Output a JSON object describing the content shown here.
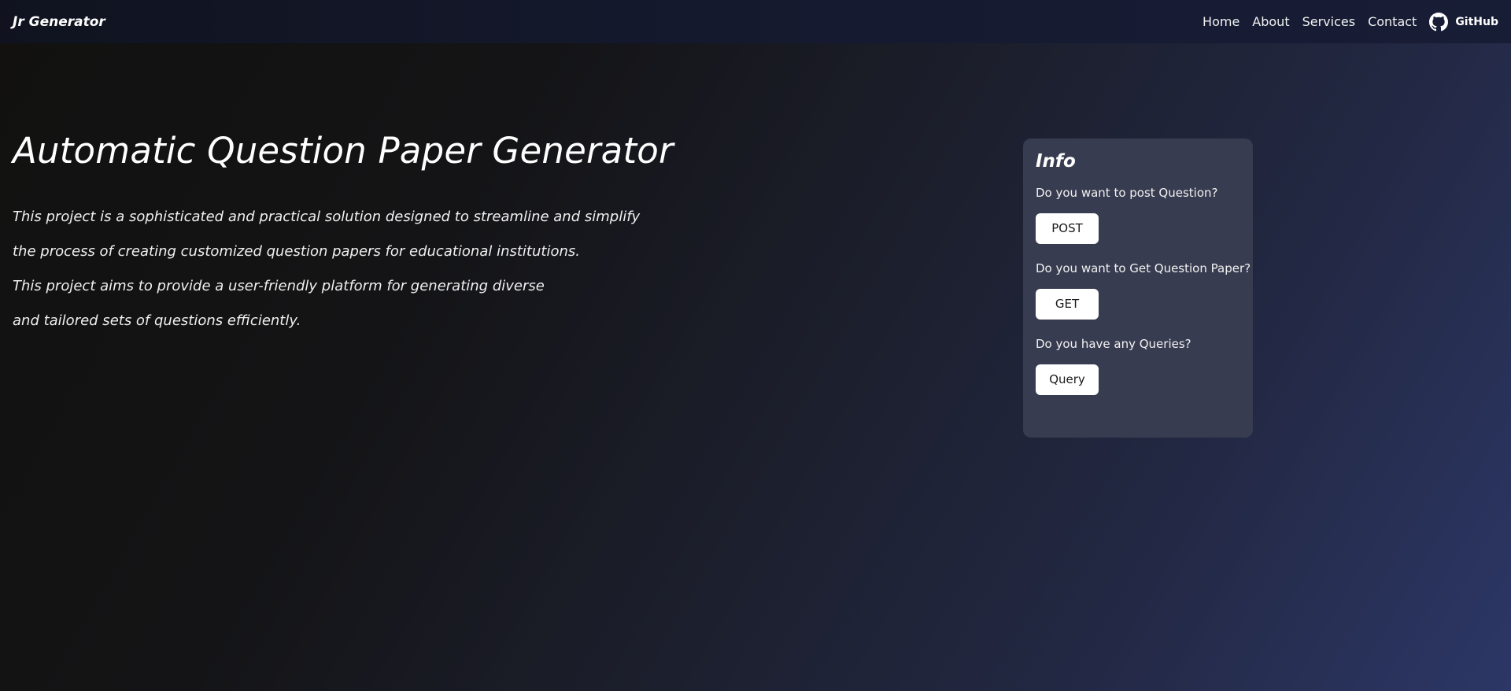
{
  "navbar": {
    "brand": "Jr Generator",
    "links": [
      {
        "label": "Home"
      },
      {
        "label": "About"
      },
      {
        "label": "Services"
      },
      {
        "label": "Contact"
      }
    ],
    "github": {
      "label": "GitHub",
      "icon": "github-icon"
    }
  },
  "hero": {
    "title": "Automatic Question Paper Generator",
    "lines": [
      "This project is a sophisticated and practical solution designed to streamline and simplify",
      "the process of creating customized question papers for educational institutions.",
      "This project aims to provide a user-friendly platform for generating diverse",
      "and tailored sets of questions efficiently."
    ]
  },
  "info": {
    "title": "Info",
    "items": [
      {
        "question": "Do you want to post Question?",
        "button": "POST"
      },
      {
        "question": "Do you want to Get Question Paper?",
        "button": "GET"
      },
      {
        "question": "Do you have any Queries?",
        "button": "Query"
      }
    ]
  },
  "colors": {
    "card": "#383c50",
    "navbar": "#151a30",
    "button": "#ffffff"
  }
}
